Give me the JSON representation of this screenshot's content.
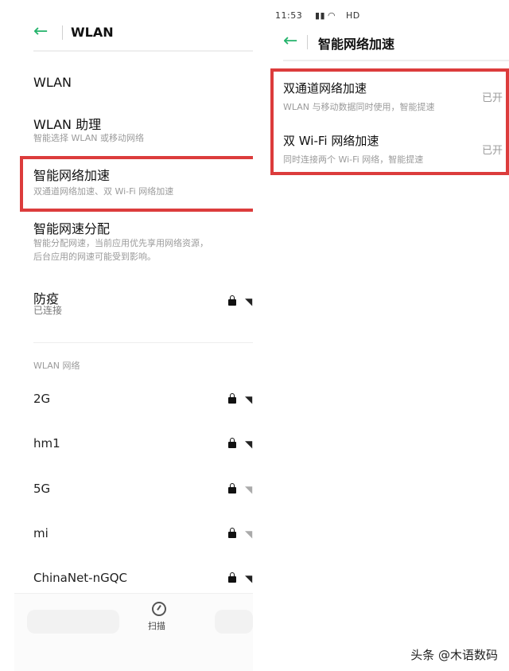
{
  "left": {
    "header": {
      "back_icon": "back-arrow-icon",
      "title": "WLAN"
    },
    "items": [
      {
        "title": "WLAN",
        "subtitle": ""
      },
      {
        "title": "WLAN 助理",
        "subtitle": "智能选择 WLAN 或移动网络"
      },
      {
        "title": "智能网络加速",
        "subtitle": "双通道网络加速、双 Wi-Fi 网络加速"
      },
      {
        "title": "智能网速分配",
        "subtitle_line1": "智能分配网速，当前应用优先享用网络资源，",
        "subtitle_line2": "后台应用的网速可能受到影响。"
      }
    ],
    "connected": {
      "name": "防疫",
      "status": "已连接"
    },
    "section_label": "WLAN 网络",
    "networks": [
      {
        "name": "2G",
        "secured": true,
        "signal": "strong"
      },
      {
        "name": "hm1",
        "secured": true,
        "signal": "strong"
      },
      {
        "name": "5G",
        "secured": true,
        "signal": "weak"
      },
      {
        "name": "mi",
        "secured": true,
        "signal": "weak"
      },
      {
        "name": "ChinaNet-nGQC",
        "secured": true,
        "signal": "strong"
      }
    ],
    "bottom": {
      "scan_label": "扫描"
    }
  },
  "right": {
    "status_bar": "11:53",
    "status_hd": "HD",
    "header": {
      "title": "智能网络加速"
    },
    "options": [
      {
        "title": "双通道网络加速",
        "subtitle": "WLAN 与移动数据同时使用，智能提速",
        "state": "已开"
      },
      {
        "title": "双 Wi-Fi 网络加速",
        "subtitle": "同时连接两个 Wi-Fi 网络，智能提速",
        "state": "已开"
      }
    ]
  },
  "watermark": "头条 @木语数码",
  "colors": {
    "accent": "#24b36b",
    "highlight": "#dc3c3c",
    "subtle": "#9b9b9b"
  }
}
